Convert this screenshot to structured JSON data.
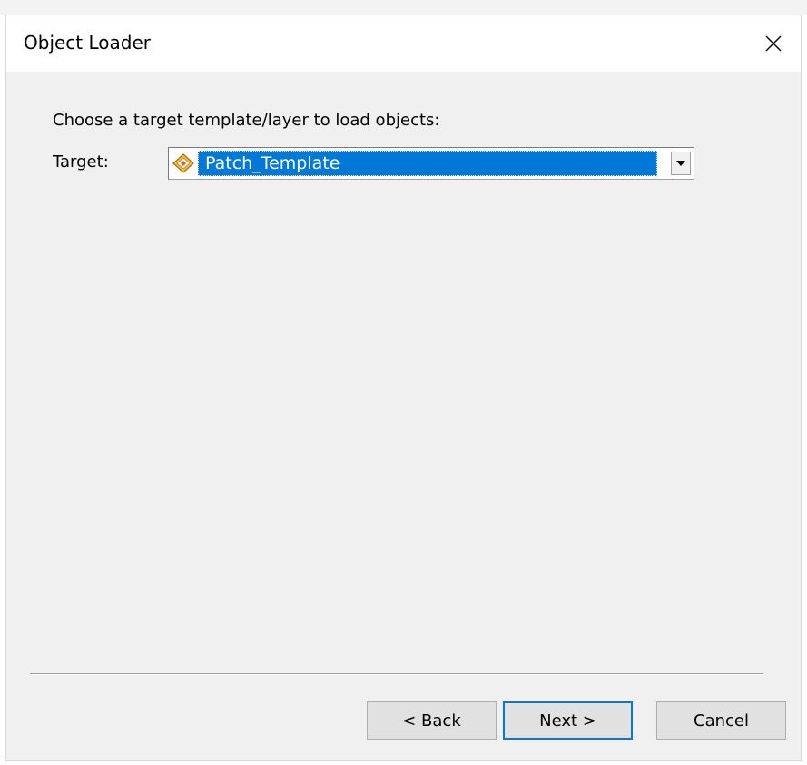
{
  "window": {
    "title": "Object Loader",
    "close_icon": "close-icon"
  },
  "content": {
    "instruction": "Choose a target template/layer to load objects:",
    "target_label": "Target:",
    "target_select": {
      "value": "Patch_Template",
      "icon": "template-diamond-icon"
    }
  },
  "buttons": {
    "back": "< Back",
    "next": "Next >",
    "cancel": "Cancel"
  },
  "colors": {
    "selection": "#0078d7",
    "dialog_bg": "#f0f0f0",
    "focus_border": "#0078d7"
  }
}
